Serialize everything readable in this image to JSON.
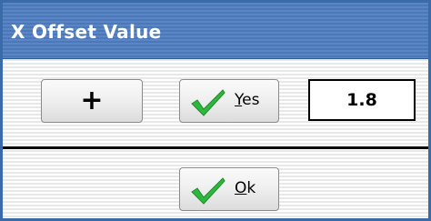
{
  "dialog": {
    "title": "X Offset Value"
  },
  "controls": {
    "plus_label": "+",
    "yes_label_first": "Y",
    "yes_label_rest": "es",
    "value": "1.8",
    "ok_label_first": "O",
    "ok_label_rest": "k"
  },
  "icons": {
    "check": "checkmark-icon",
    "check_color": "#2db83d"
  }
}
